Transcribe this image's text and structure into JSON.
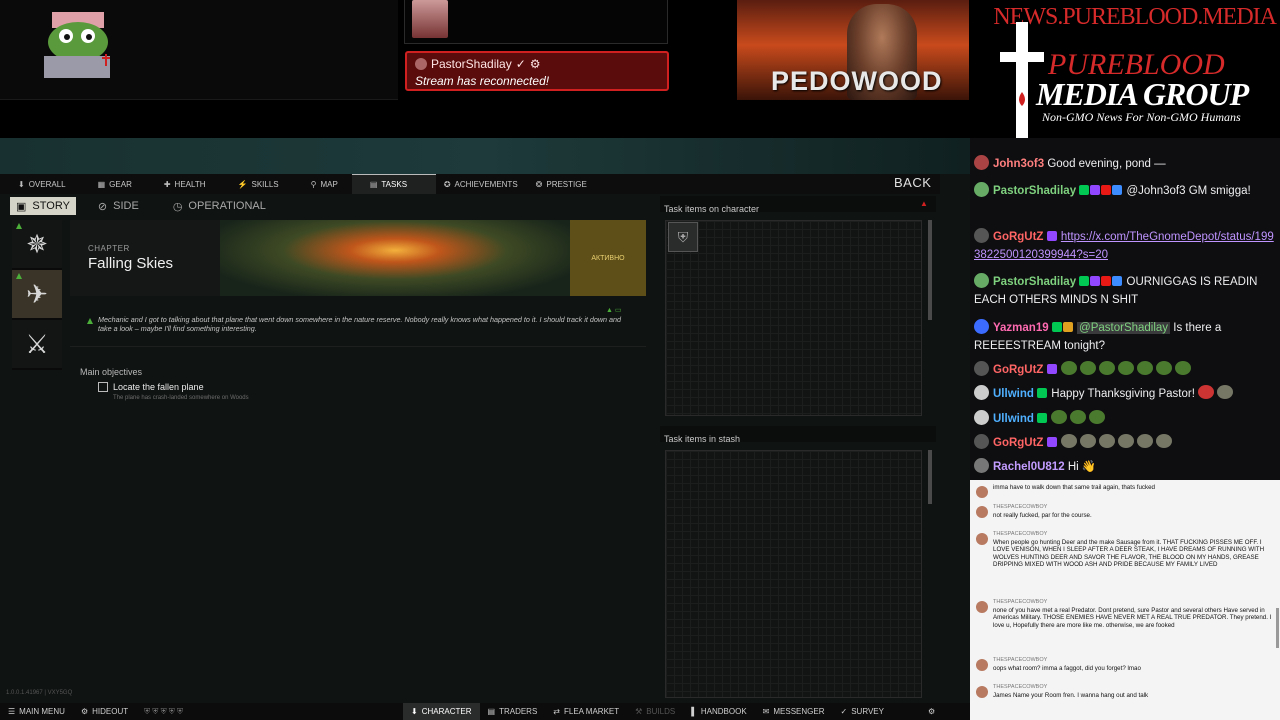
{
  "overlay": {
    "reconnect_user": "PastorShadilay",
    "reconnect_msg": "Stream has reconnected!",
    "video_text": "PEDOWOOD",
    "brand_url": "NEWS.PUREBLOOD.MEDIA",
    "brand_line1": "PUREBLOOD",
    "brand_line2": "MEDIA GROUP",
    "brand_tagline": "Non-GMO News For Non-GMO Humans"
  },
  "game": {
    "tabs": [
      {
        "label": "OVERALL",
        "icon": "person-icon"
      },
      {
        "label": "GEAR",
        "icon": "gear-bag-icon"
      },
      {
        "label": "HEALTH",
        "icon": "health-icon"
      },
      {
        "label": "SKILLS",
        "icon": "skills-icon"
      },
      {
        "label": "MAP",
        "icon": "map-pin-icon"
      },
      {
        "label": "TASKS",
        "icon": "tasks-icon"
      },
      {
        "label": "ACHIEVEMENTS",
        "icon": "trophy-icon"
      },
      {
        "label": "PRESTIGE",
        "icon": "prestige-icon"
      }
    ],
    "active_tab": "TASKS",
    "back_label": "BACK",
    "subtabs": [
      "STORY",
      "SIDE",
      "OPERATIONAL"
    ],
    "active_subtab": "STORY",
    "chapter_label": "CHAPTER",
    "chapter_title": "Falling Skies",
    "chapter_status": "АКТИВНО",
    "description": "Mechanic and I got to talking about that plane that went down somewhere in the nature reserve. Nobody really knows what happened to it. I should track it down and take a look – maybe I'll find something interesting.",
    "objectives_header": "Main objectives",
    "objective_title": "Locate the fallen plane",
    "objective_sub": "The plane has crash-landed somewhere on Woods",
    "char_items_title": "Task items on character",
    "stash_items_title": "Task items in stash",
    "version": "1.0.0.1.41967 | VXY5GQ",
    "bottom_bar": {
      "main_menu": "MAIN MENU",
      "hideout": "HIDEOUT",
      "character": "CHARACTER",
      "traders": "TRADERS",
      "flea": "FLEA MARKET",
      "builds": "BUILDS",
      "handbook": "HANDBOOK",
      "messenger": "MESSENGER",
      "survey": "SURVEY"
    }
  },
  "chat": {
    "messages": [
      {
        "user": "John3of3",
        "cls": "n-john",
        "text": "Good evening, pond —"
      },
      {
        "user": "PastorShadilay",
        "cls": "n-pastor",
        "text": "@John3of3 GM smigga!"
      },
      {
        "user": "GoRgUtZ",
        "cls": "n-gorg",
        "link": "https://x.com/TheGnomeDepot/status/1993822500120399944?s=20"
      },
      {
        "user": "PastorShadilay",
        "cls": "n-pastor",
        "text": "OURNIGGAS IS READIN EACH OTHERS MINDS N SHIT"
      },
      {
        "user": "Yazman19",
        "cls": "n-yaz",
        "mention": "@PastorShadilay",
        "text": "Is there a REEEESTREAM tonight?"
      },
      {
        "user": "GoRgUtZ",
        "cls": "n-gorg",
        "text": ""
      },
      {
        "user": "Ullwind",
        "cls": "n-ull",
        "text": "Happy Thanksgiving Pastor!"
      },
      {
        "user": "Ullwind",
        "cls": "n-ull",
        "text": ""
      },
      {
        "user": "GoRgUtZ",
        "cls": "n-gorg",
        "text": ""
      },
      {
        "user": "Rachel0U812",
        "cls": "n-rach",
        "text": "Hi 👋"
      }
    ],
    "yt_messages": [
      {
        "user": "",
        "text": "imma have to walk down that same trail again, thats fucked"
      },
      {
        "user": "THESPACECOWBOY",
        "text": "not really fucked, par for the course."
      },
      {
        "user": "THESPACECOWBOY",
        "text": "When people go hunting Deer and the make Sausage from it. THAT FUCKING PISSES ME OFF. I LOVE VENISON, WHEN I SLEEP AFTER A DEER STEAK, I HAVE DREAMS OF RUNNING WITH WOLVES HUNTING DEER AND SAVOR THE FLAVOR, THE BLOOD ON MY HANDS, GREASE DRIPPING MIXED WITH WOOD ASH AND PRIDE BECAUSE MY FAMILY LIVED"
      },
      {
        "user": "THESPACECOWBOY",
        "text": "none of you have met a real Predator. Dont pretend, sure Pastor and several others Have served in Americas Military. THOSE ENEMIES HAVE NEVER MET A REAL TRUE PREDATOR. They pretend. I love u, Hopefully there are more like me. otherwise, we are fooked"
      },
      {
        "user": "THESPACECOWBOY",
        "text": "oops what room? imma a faggot, did you forget? lmao"
      },
      {
        "user": "THESPACECOWBOY",
        "text": "James Name your Room fren. I wanna hang out and talk"
      }
    ]
  },
  "colors": {
    "accent_red": "#d02020",
    "tasks_green": "#4caf3a",
    "chat_bg": "#0e0e10"
  }
}
